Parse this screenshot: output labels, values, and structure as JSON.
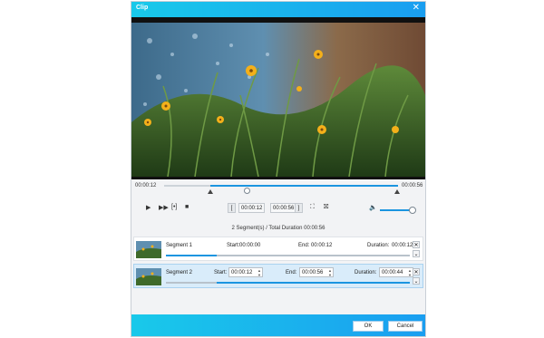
{
  "window": {
    "title": "Clip"
  },
  "player": {
    "current_time": "00:00:12",
    "end_time": "00:00:56",
    "start_box": "00:00:12",
    "end_box": "00:00:56",
    "volume_level": 0.9
  },
  "segments_summary": "2 Segment(s) / Total Duration 00:00:56",
  "segments": [
    {
      "name": "Segment 1",
      "start_label": "Start:",
      "start": "00:00:00",
      "end_label": "End:",
      "end": "00:00:12",
      "duration_label": "Duration:",
      "duration": "00:00:12",
      "range": [
        0.0,
        0.21
      ]
    },
    {
      "name": "Segment 2",
      "start_label": "Start:",
      "start": "00:00:12",
      "end_label": "End:",
      "end": "00:00:56",
      "duration_label": "Duration:",
      "duration": "00:00:44",
      "range": [
        0.21,
        1.0
      ]
    }
  ],
  "buttons": {
    "ok": "OK",
    "cancel": "Cancel"
  },
  "icons": [
    "close-icon",
    "play-icon",
    "fast-forward-icon",
    "merge-icon",
    "stop-icon",
    "set-start-icon",
    "set-end-icon",
    "crop-icon",
    "delete-segment-icon",
    "volume-icon",
    "remove-icon",
    "expand-icon"
  ],
  "colors": {
    "accent": "#1b95e0",
    "titlebar_start": "#19c9ea",
    "titlebar_end": "#1a9ef0",
    "selected_row": "#d9ecfa"
  }
}
